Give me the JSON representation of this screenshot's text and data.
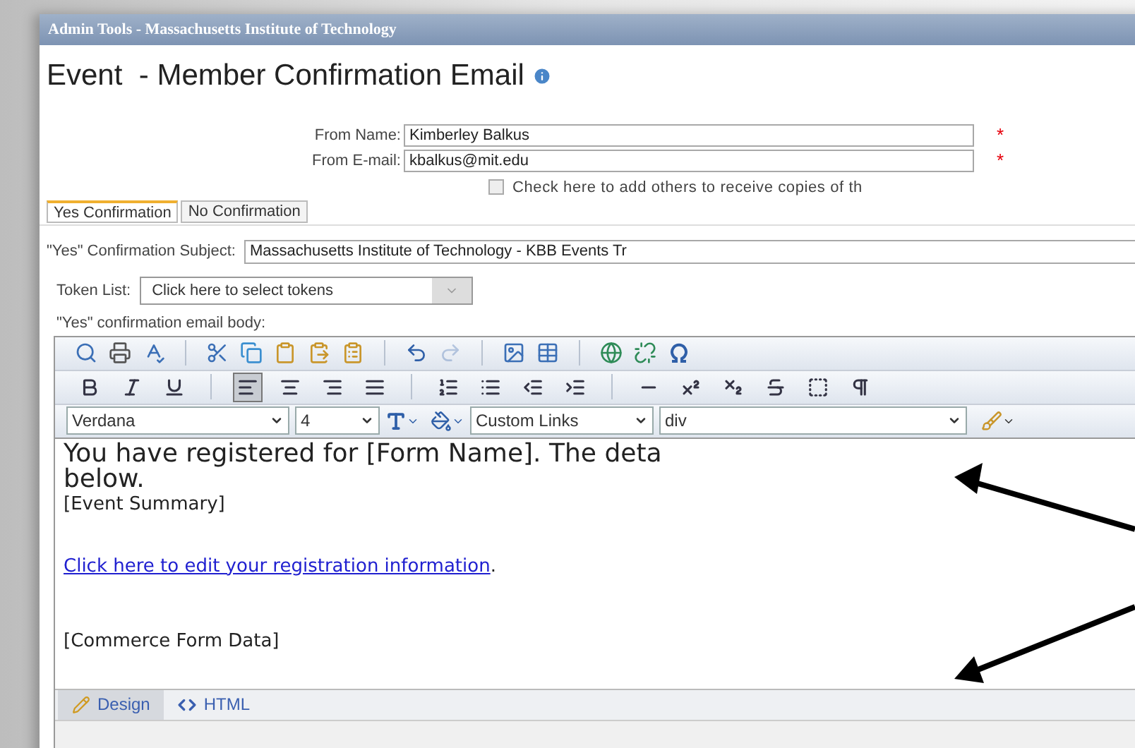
{
  "window": {
    "title": "Admin Tools - Massachusetts Institute of Technology"
  },
  "heading": "Event  - Member Confirmation Email",
  "from_fields": [
    {
      "label": "From Name:",
      "value": "Kimberley Balkus",
      "required": "*"
    },
    {
      "label": "From E-mail:",
      "value": "kbalkus@mit.edu",
      "required": "*"
    }
  ],
  "copies_checkbox": {
    "label": "Check here to add others to receive copies of th",
    "checked": false
  },
  "tabs": [
    {
      "label": "Yes Confirmation",
      "selected": true
    },
    {
      "label": "No Confirmation",
      "selected": false
    }
  ],
  "subject": {
    "label": "\"Yes\" Confirmation Subject:",
    "value": "Massachusetts Institute of Technology - KBB Events Tr"
  },
  "token_list": {
    "label": "Token List:",
    "value": "Click here to select tokens"
  },
  "body_label": "\"Yes\" confirmation email body:",
  "toolbar_1": [
    {
      "kind": "find",
      "disabled": false
    },
    {
      "kind": "print",
      "disabled": false
    },
    {
      "kind": "spell",
      "disabled": false
    },
    {
      "kind": "sep"
    },
    {
      "kind": "cut",
      "disabled": false
    },
    {
      "kind": "copy",
      "disabled": false
    },
    {
      "kind": "paste",
      "disabled": false
    },
    {
      "kind": "paste_word",
      "disabled": false
    },
    {
      "kind": "paste_text",
      "disabled": false
    },
    {
      "kind": "sep"
    },
    {
      "kind": "undo",
      "disabled": false
    },
    {
      "kind": "redo",
      "disabled": true
    },
    {
      "kind": "sep"
    },
    {
      "kind": "image",
      "disabled": false
    },
    {
      "kind": "table",
      "disabled": false
    },
    {
      "kind": "sep"
    },
    {
      "kind": "link",
      "disabled": false
    },
    {
      "kind": "unlink",
      "disabled": false
    },
    {
      "kind": "symbol",
      "disabled": false
    }
  ],
  "toolbar_2": [
    {
      "kind": "bold",
      "active": false
    },
    {
      "kind": "italic",
      "active": false
    },
    {
      "kind": "underline",
      "active": false
    },
    {
      "kind": "sep"
    },
    {
      "kind": "align_left",
      "active": true
    },
    {
      "kind": "align_center",
      "active": false
    },
    {
      "kind": "align_right",
      "active": false
    },
    {
      "kind": "align_justify",
      "active": false
    },
    {
      "kind": "sep"
    },
    {
      "kind": "ordered_list",
      "active": false
    },
    {
      "kind": "bullet_list",
      "active": false
    },
    {
      "kind": "outdent",
      "active": false
    },
    {
      "kind": "indent",
      "active": false
    },
    {
      "kind": "sep"
    },
    {
      "kind": "rule",
      "active": false
    },
    {
      "kind": "superscript",
      "active": false
    },
    {
      "kind": "subscript",
      "active": false
    },
    {
      "kind": "strike",
      "active": false
    },
    {
      "kind": "frame",
      "active": false
    },
    {
      "kind": "paragraph",
      "active": false
    }
  ],
  "font_select": "Verdana",
  "size_select": "4",
  "links_select": "Custom Links",
  "block_select": "div",
  "body": {
    "line_1": "You have registered for [Form Name]. The deta",
    "line_2": "below.",
    "summary": "[Event Summary]",
    "link": "Click here to edit your registration information",
    "link_after": ".",
    "commerce": "[Commerce Form Data]"
  },
  "mode_tabs": [
    {
      "kind": "design",
      "label": "Design",
      "selected": true
    },
    {
      "kind": "html",
      "label": "HTML",
      "selected": false
    }
  ]
}
